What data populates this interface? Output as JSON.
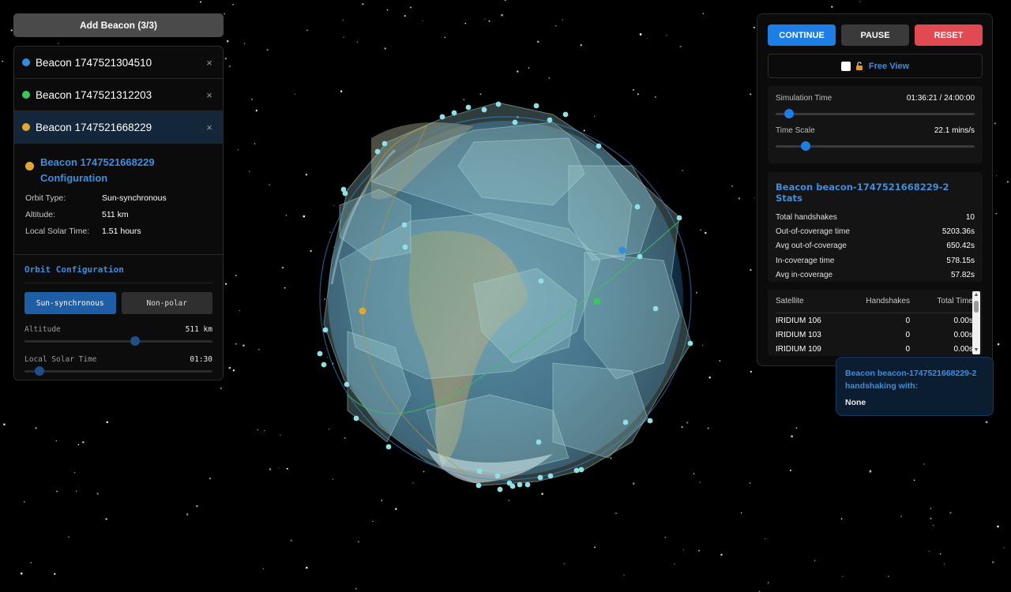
{
  "header": {
    "add_beacon_label": "Add Beacon (3/3)"
  },
  "beacons": [
    {
      "name": "Beacon 1747521304510",
      "color": "#2f8fdc",
      "close": "×"
    },
    {
      "name": "Beacon 1747521312203",
      "color": "#38c85a",
      "close": "×"
    },
    {
      "name": "Beacon 1747521668229",
      "color": "#e0a82e",
      "close": "×"
    }
  ],
  "config": {
    "title": "Beacon 1747521668229 Configuration",
    "rows": [
      {
        "k": "Orbit Type:",
        "v": "Sun-synchronous"
      },
      {
        "k": "Altitude:",
        "v": "511 km"
      },
      {
        "k": "Local Solar Time:",
        "v": "1.51 hours"
      }
    ]
  },
  "orbit": {
    "title": "Orbit Configuration",
    "tabs": [
      "Sun-synchronous",
      "Non-polar"
    ],
    "altitude_label": "Altitude",
    "altitude_value": "511 km",
    "altitude_fraction": 0.59,
    "lst_label": "Local Solar Time",
    "lst_value": "01:30",
    "lst_fraction": 0.08
  },
  "controls": {
    "continue": "CONTINUE",
    "pause": "PAUSE",
    "reset": "RESET",
    "free_view": "Free View"
  },
  "simulation": {
    "time_label": "Simulation Time",
    "time_value": "01:36:21 / 24:00:00",
    "time_fraction": 0.067,
    "scale_label": "Time Scale",
    "scale_value": "22.1 mins/s",
    "scale_fraction": 0.15
  },
  "stats": {
    "title": "Beacon beacon-1747521668229-2 Stats",
    "rows": [
      {
        "k": "Total handshakes",
        "v": "10"
      },
      {
        "k": "Out-of-coverage time",
        "v": "5203.36s"
      },
      {
        "k": "Avg out-of-coverage",
        "v": "650.42s"
      },
      {
        "k": "In-coverage time",
        "v": "578.15s"
      },
      {
        "k": "Avg in-coverage",
        "v": "57.82s"
      }
    ]
  },
  "satellites": {
    "headers": [
      "Satellite",
      "Handshakes",
      "Total Time"
    ],
    "rows": [
      [
        "IRIDIUM 106",
        "0",
        "0.00s"
      ],
      [
        "IRIDIUM 103",
        "0",
        "0.00s"
      ],
      [
        "IRIDIUM 109",
        "0",
        "0.00s"
      ]
    ]
  },
  "handshake": {
    "title": "Beacon beacon-1747521668229-2 handshaking with:",
    "value": "None"
  }
}
